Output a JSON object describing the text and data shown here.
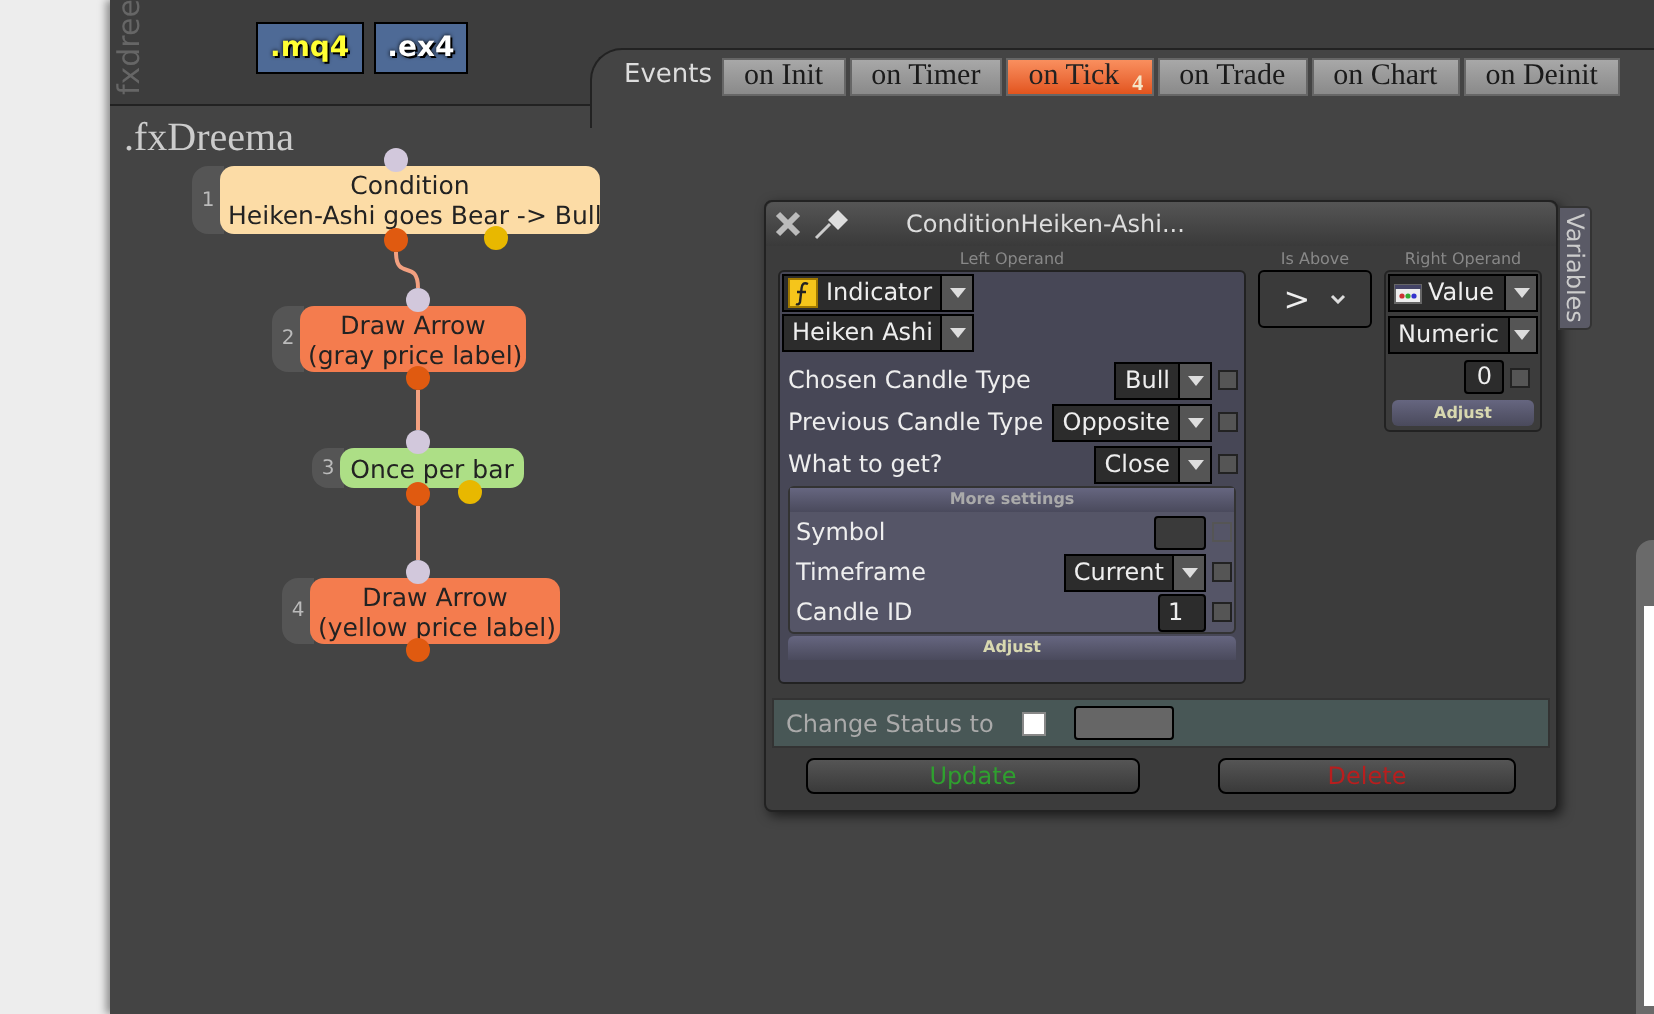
{
  "sidebar_label": "fxdree",
  "files": [
    {
      "label": ".mq4",
      "kind": "source"
    },
    {
      "label": ".ex4",
      "kind": "compiled"
    }
  ],
  "events_label": "Events",
  "tabs": [
    {
      "label": "on Init",
      "selected": false
    },
    {
      "label": "on Timer",
      "selected": false
    },
    {
      "label": "on Tick",
      "selected": true,
      "badge": "4"
    },
    {
      "label": "on Trade",
      "selected": false
    },
    {
      "label": "on Chart",
      "selected": false
    },
    {
      "label": "on Deinit",
      "selected": false
    }
  ],
  "canvas_title": ".fxDreema",
  "blocks": [
    {
      "number": "1",
      "lines": [
        "Condition",
        "Heiken-Ashi goes Bear -> Bull"
      ],
      "color": "#fcdca6",
      "false_output": true
    },
    {
      "number": "2",
      "lines": [
        "Draw Arrow",
        "(gray price label)"
      ],
      "color": "#f47c4e",
      "false_output": false
    },
    {
      "number": "3",
      "lines": [
        "Once per bar"
      ],
      "color": "#addf86",
      "false_output": true
    },
    {
      "number": "4",
      "lines": [
        "Draw Arrow",
        "(yellow price label)"
      ],
      "color": "#f47c4e",
      "false_output": false
    }
  ],
  "dialog": {
    "title": "ConditionHeiken-Ashi...",
    "left_operand": {
      "heading": "Left Operand",
      "type": "Indicator",
      "indicator": "Heiken Ashi",
      "params": [
        {
          "label": "Chosen Candle Type",
          "kind": "select",
          "value": "Bull",
          "checked": false
        },
        {
          "label": "Previous Candle Type",
          "kind": "select",
          "value": "Opposite",
          "checked": false
        },
        {
          "label": "What to get?",
          "kind": "select",
          "value": "Close",
          "checked": false
        }
      ],
      "more_settings": {
        "heading": "More settings",
        "params": [
          {
            "label": "Symbol",
            "kind": "text",
            "checked": false,
            "disabled": true
          },
          {
            "label": "Timeframe",
            "kind": "select",
            "value": "Current",
            "checked": false,
            "disabled": false
          },
          {
            "label": "Candle ID",
            "kind": "number",
            "value": "1",
            "checked": false,
            "disabled": false
          }
        ]
      },
      "adjust": "Adjust"
    },
    "operator": {
      "heading": "Is Above",
      "symbol": ">"
    },
    "right_operand": {
      "heading": "Right Operand",
      "type": "Value",
      "format": "Numeric",
      "value": "0",
      "checked": false,
      "adjust": "Adjust"
    },
    "status": {
      "label": "Change Status to",
      "checked": false
    },
    "buttons": [
      {
        "label": "Update",
        "kind": "update"
      },
      {
        "label": "Delete",
        "kind": "delete"
      }
    ]
  },
  "variables_tab": "Variables"
}
